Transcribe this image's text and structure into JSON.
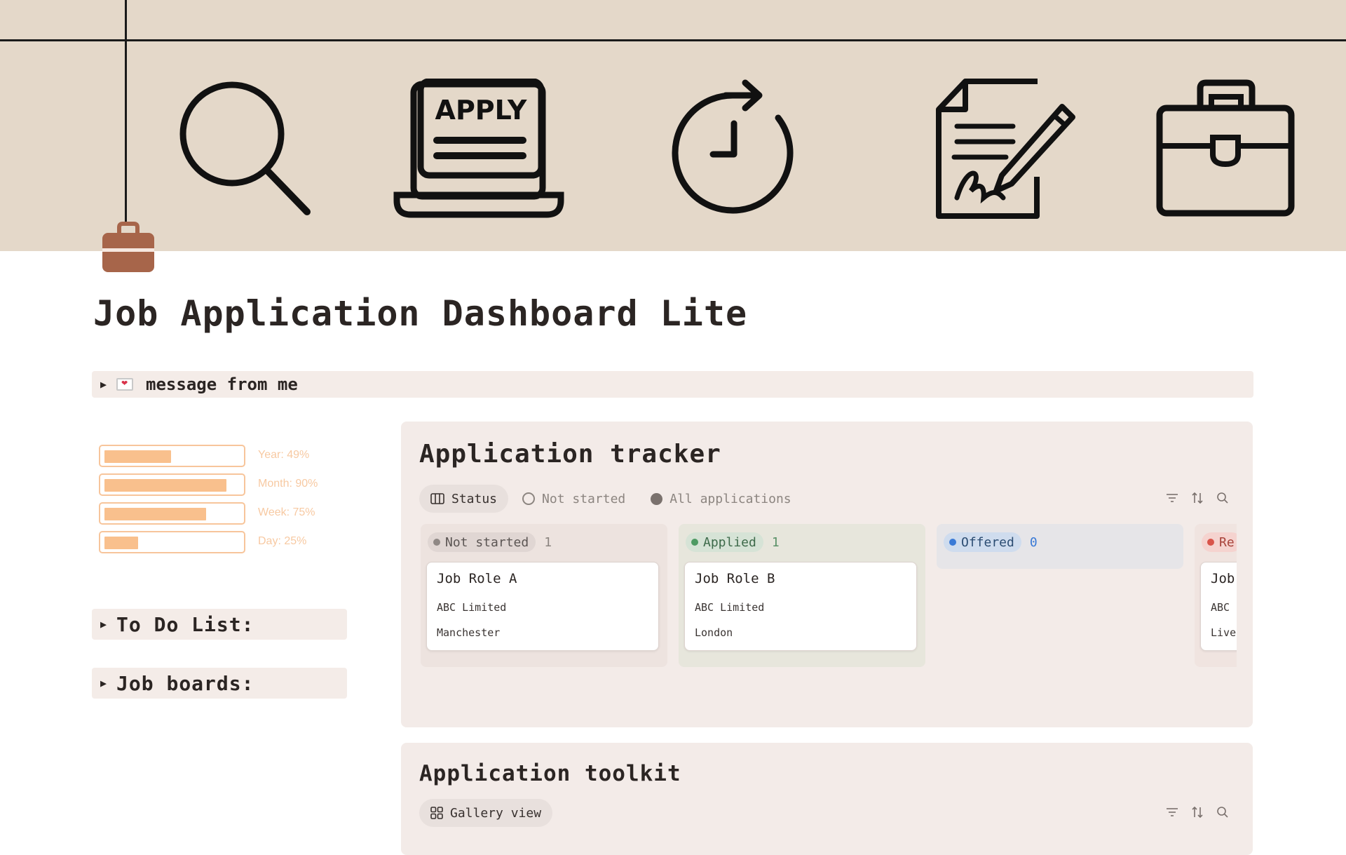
{
  "colors": {
    "cover_bg": "#e4d8c9",
    "panel_bg": "#f3ebe8",
    "progress_fill": "#f9c08d",
    "progress_border": "#f7c59b",
    "title": "#2b2523"
  },
  "cover": {
    "icons": [
      "search-icon",
      "apply-laptop-icon",
      "clock-refresh-icon",
      "contract-signature-icon",
      "briefcase-icon"
    ],
    "apply_text": "APPLY"
  },
  "page": {
    "icon": "briefcase-icon",
    "title": "Job Application Dashboard Lite"
  },
  "message_toggle": {
    "icon": "love-letter-icon",
    "label": "message from me"
  },
  "progress": [
    {
      "label": "Year: 49%",
      "value": 0.49
    },
    {
      "label": "Month: 90%",
      "value": 0.9
    },
    {
      "label": "Week: 75%",
      "value": 0.75
    },
    {
      "label": "Day: 25%",
      "value": 0.25
    }
  ],
  "todo_toggle": {
    "label": "To Do List:"
  },
  "boards_toggle": {
    "label": "Job boards:"
  },
  "tracker": {
    "title": "Application tracker",
    "tabs": [
      {
        "label": "Status",
        "icon": "board-columns-icon",
        "active": true
      },
      {
        "label": "Not started",
        "icon": "circle-outline-icon",
        "active": false
      },
      {
        "label": "All applications",
        "icon": "circle-filled-icon",
        "active": false
      }
    ],
    "tools": [
      "filter-icon",
      "sort-icon",
      "search-icon"
    ],
    "columns": [
      {
        "status": "Not started",
        "count": "1",
        "color": "gray",
        "cards": [
          {
            "role": "Job Role A",
            "company": "ABC Limited",
            "city": "Manchester"
          }
        ]
      },
      {
        "status": "Applied",
        "count": "1",
        "color": "green",
        "cards": [
          {
            "role": "Job Role B",
            "company": "ABC Limited",
            "city": "London"
          }
        ]
      },
      {
        "status": "Offered",
        "count": "0",
        "color": "blue",
        "cards": []
      },
      {
        "status": "Re",
        "count": "",
        "color": "red",
        "cards": [
          {
            "role": "Job",
            "company": "ABC",
            "city": "Live"
          }
        ]
      }
    ]
  },
  "toolkit": {
    "title": "Application toolkit",
    "tabs": [
      {
        "label": "Gallery view",
        "icon": "gallery-grid-icon",
        "active": true
      }
    ],
    "tools": [
      "filter-icon",
      "sort-icon",
      "search-icon"
    ]
  }
}
